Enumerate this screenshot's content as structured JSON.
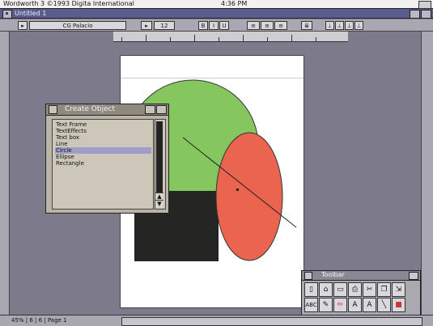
{
  "screen": {
    "app_title": "Wordworth 3  ©1993 Digita International",
    "clock": "4:36 PM"
  },
  "window": {
    "title": "Untitled 1"
  },
  "format_bar": {
    "font_name": "CG Palacio",
    "font_size": "12",
    "style_buttons": [
      "B",
      "I",
      "U"
    ]
  },
  "create_object": {
    "title": "Create Object",
    "items": [
      "Text Frame",
      "TextEffects",
      "Text box",
      "Line",
      "Circle",
      "Ellipse",
      "Rectangle"
    ],
    "selected": "Circle"
  },
  "toolbar": {
    "title": "Toolbar",
    "tools": [
      "new-doc",
      "open-folder",
      "save",
      "print",
      "cut",
      "copy",
      "paste",
      "spell-check",
      "text-tool",
      "pencil",
      "text-a",
      "text-a-outline",
      "line-tool",
      "fill-tool"
    ],
    "text_glyphs": {
      "spell": "ABC",
      "a1": "A",
      "a2": "A"
    }
  },
  "status": {
    "text": "45% | 6 | 6 | Page 1"
  },
  "colors": {
    "circle_green": "#86c65f",
    "ellipse_red": "#ea6450",
    "rect_dark": "#252523",
    "desktop": "#7d7a8c",
    "selection": "#9f9ec8"
  }
}
